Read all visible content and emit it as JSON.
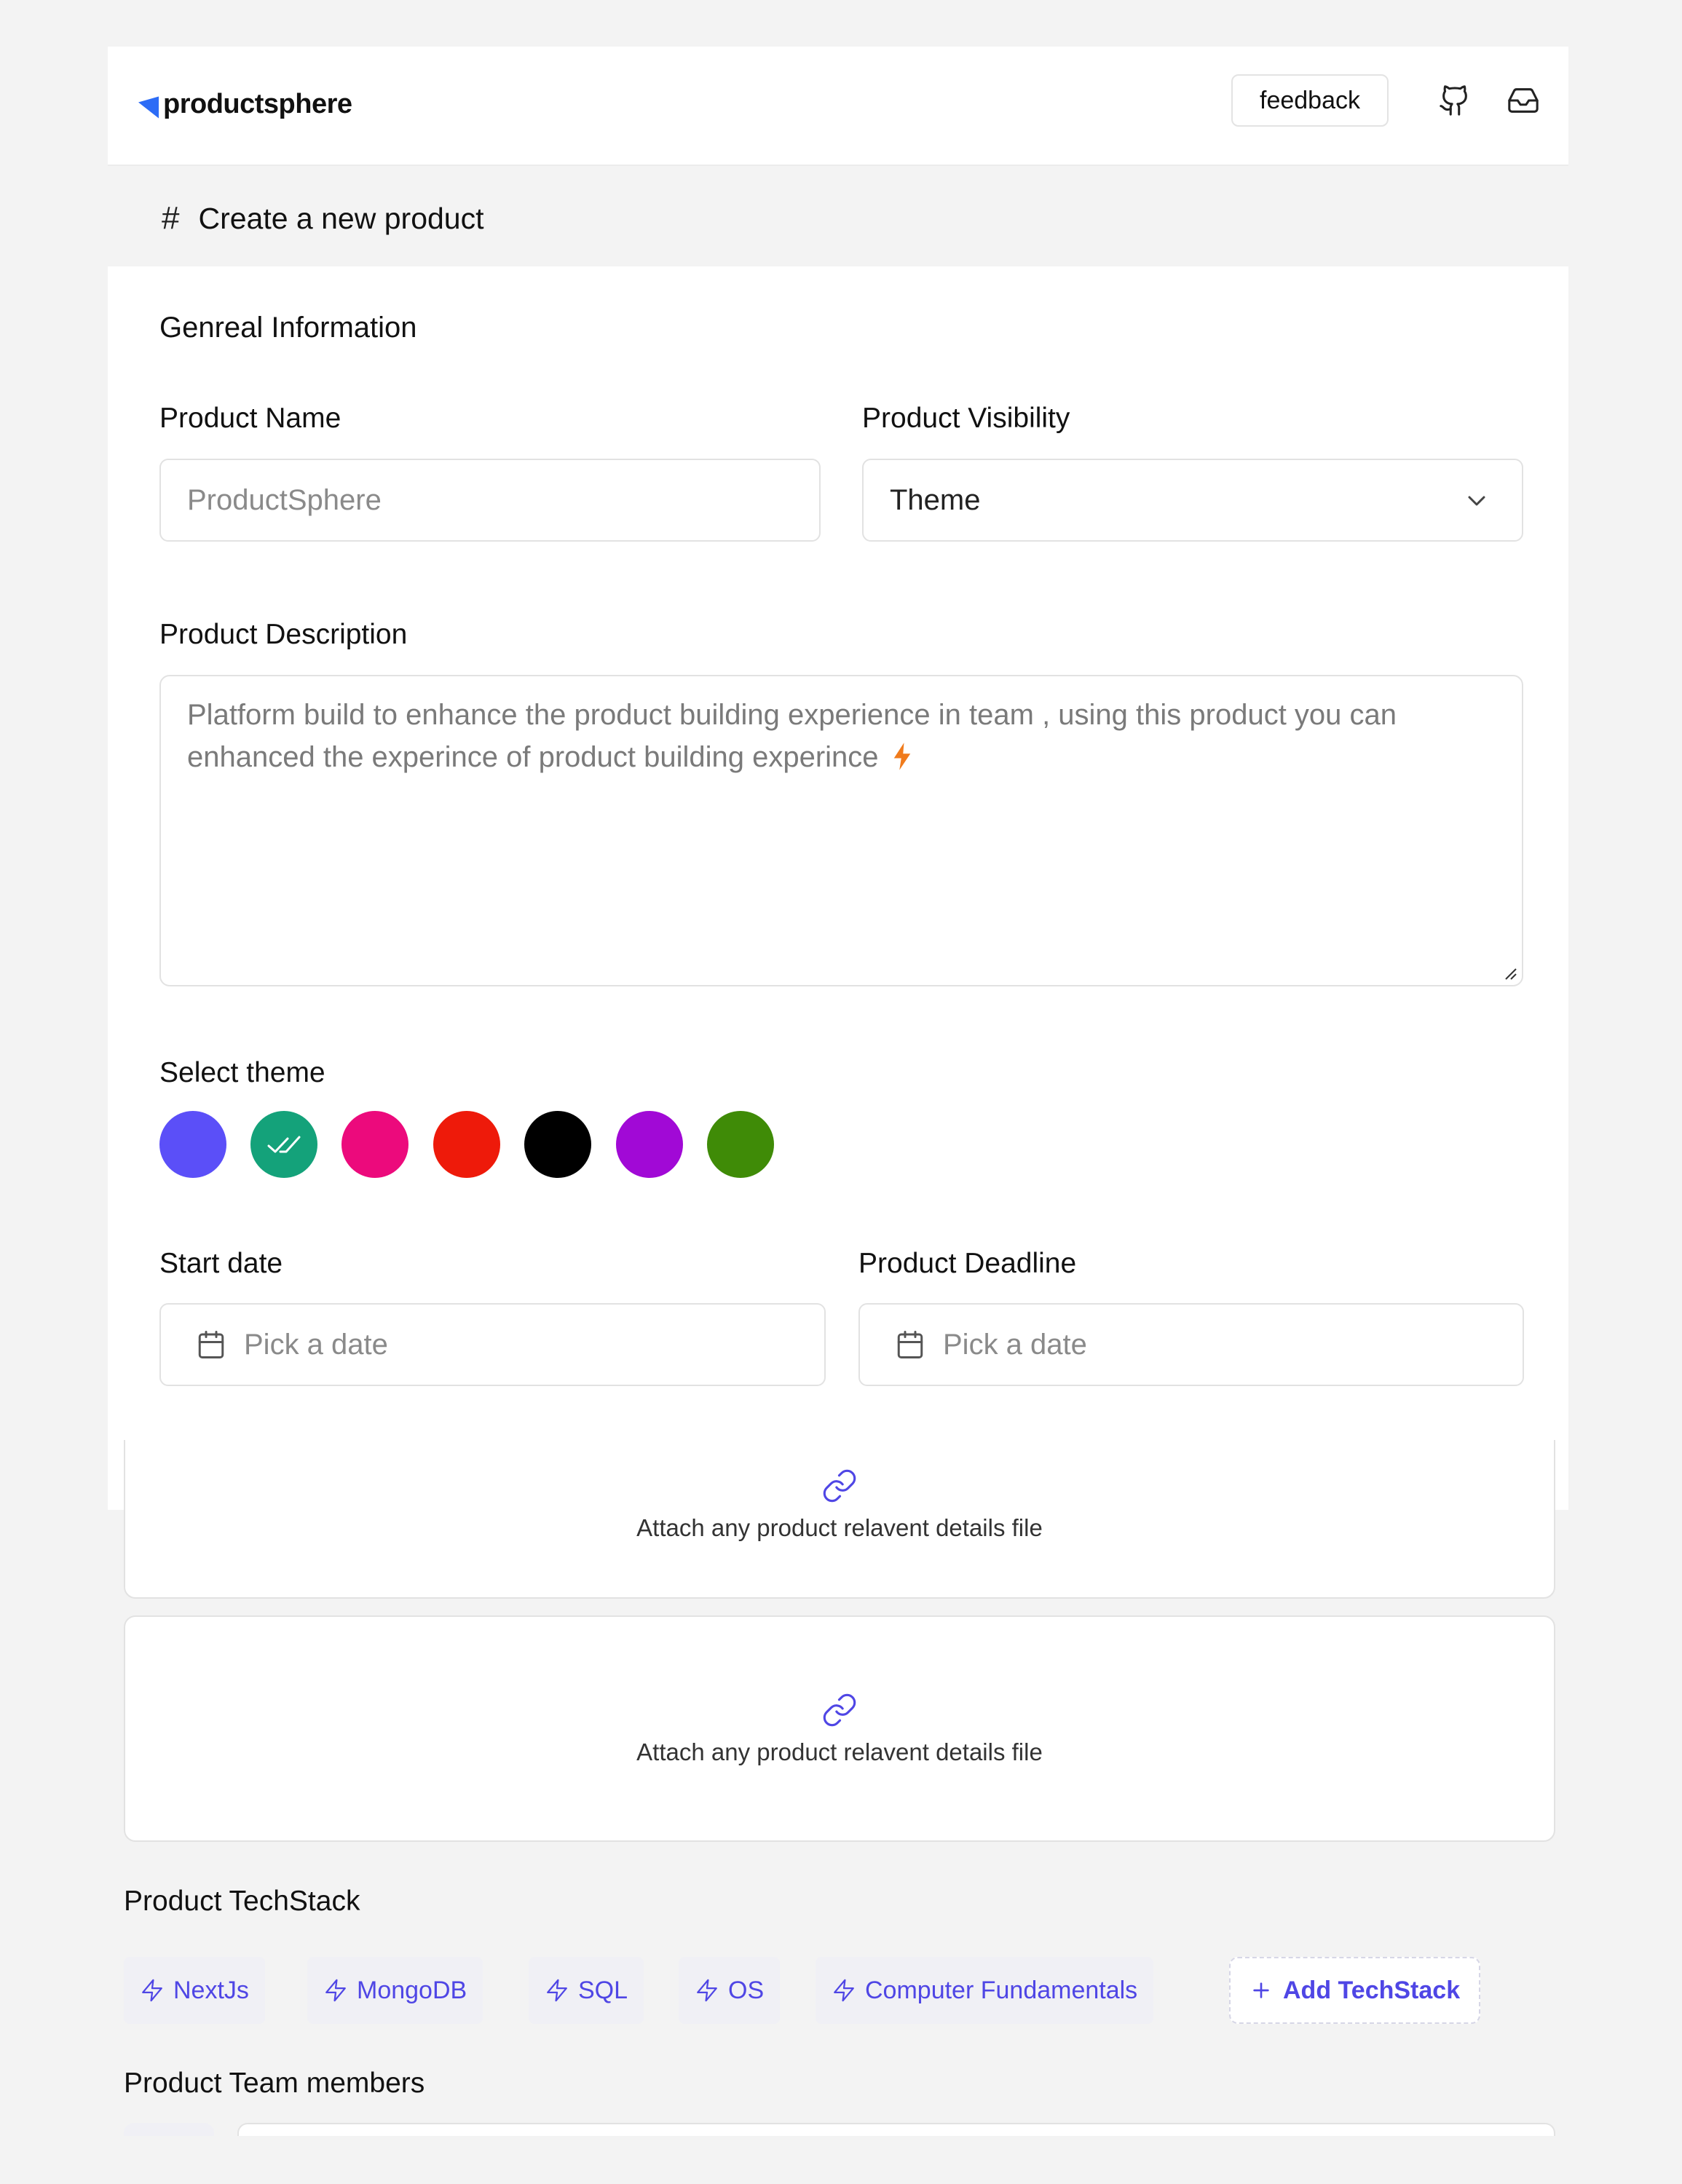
{
  "header": {
    "brand": "productsphere",
    "feedback_label": "feedback",
    "icons": [
      "github-icon",
      "inbox-icon"
    ]
  },
  "page": {
    "title": "Create a new product"
  },
  "form": {
    "section_title": "Genreal Information",
    "product_name": {
      "label": "Product Name",
      "placeholder": "ProductSphere"
    },
    "product_visibility": {
      "label": "Product Visibility",
      "value": "Theme"
    },
    "product_description": {
      "label": "Product Description",
      "placeholder": "Platform build to enhance the product building experience in team , using this product you can enhanced the experince of product building experince"
    },
    "theme": {
      "label": "Select theme",
      "colors": [
        "#5b4ff8",
        "#14a27a",
        "#ec0a7c",
        "#ee1a0a",
        "#000000",
        "#a109d6",
        "#3f8b07"
      ],
      "selected": "#14a27a"
    },
    "start_date": {
      "label": "Start date",
      "placeholder": "Pick a date"
    },
    "deadline": {
      "label": "Product Deadline",
      "placeholder": "Pick a date"
    },
    "attachments": [
      {
        "text": "Attach any product relavent details file"
      },
      {
        "text": "Attach any product relavent details file"
      }
    ],
    "techstack": {
      "label": "Product TechStack",
      "items": [
        "NextJs",
        "MongoDB",
        "SQL",
        "OS",
        "Computer Fundamentals"
      ],
      "add_label": "Add TechStack"
    },
    "team": {
      "label": "Product Team members"
    }
  },
  "colors": {
    "accent": "#4f46e5",
    "brand": "#2d6cf6",
    "bolt": "#f07b1c"
  }
}
